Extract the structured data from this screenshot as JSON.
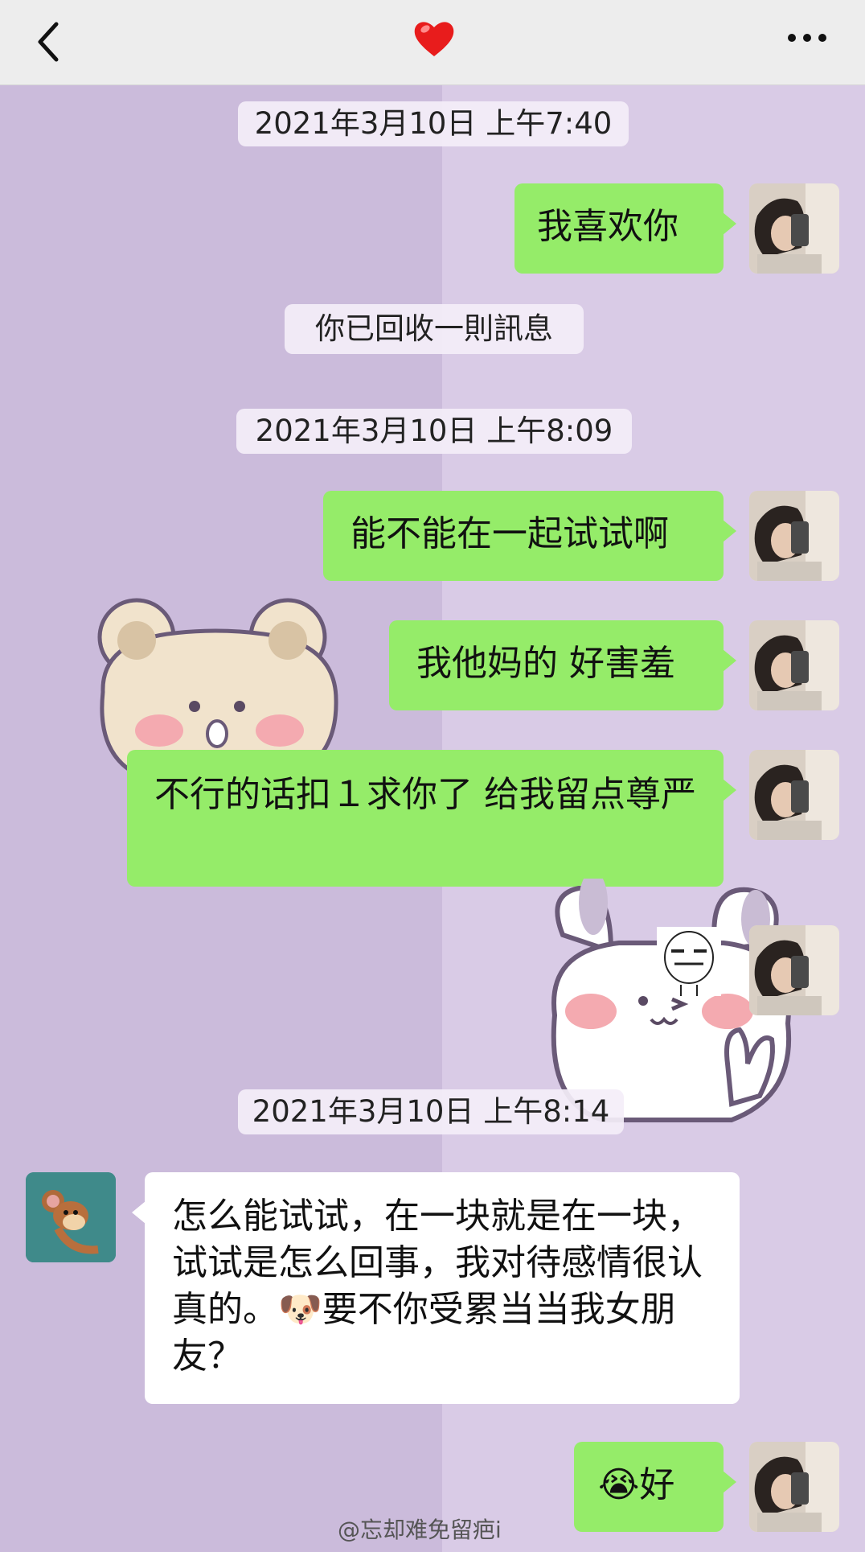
{
  "header": {
    "title_icon": "heart-icon",
    "back_icon": "chevron-left-icon",
    "more_icon": "more-horizontal-icon"
  },
  "timestamps": [
    "2021年3月10日 上午7:40",
    "2021年3月10日 上午8:09",
    "2021年3月10日 上午8:14"
  ],
  "system": {
    "recalled": "你已回收一則訊息"
  },
  "messages": [
    {
      "side": "right",
      "text": "我喜欢你"
    },
    {
      "side": "right",
      "text": "能不能在一起试试啊"
    },
    {
      "side": "right",
      "text": "我他妈的 好害羞"
    },
    {
      "side": "right",
      "text": "不行的话扣１求你了 给我留点尊严"
    },
    {
      "side": "left",
      "text": "怎么能试试，在一块就是在一块，试试是怎么回事，我对待感情很认真的。🐶要不你受累当当我女朋友？"
    },
    {
      "side": "right",
      "text": "😭好"
    }
  ],
  "watermark": "@忘却难免留疤i",
  "colors": {
    "green_bubble": "#95ec69",
    "white_bubble": "#ffffff",
    "background_purple": "#cdbddd",
    "topbar": "#ededed",
    "heart": "#e02020"
  }
}
